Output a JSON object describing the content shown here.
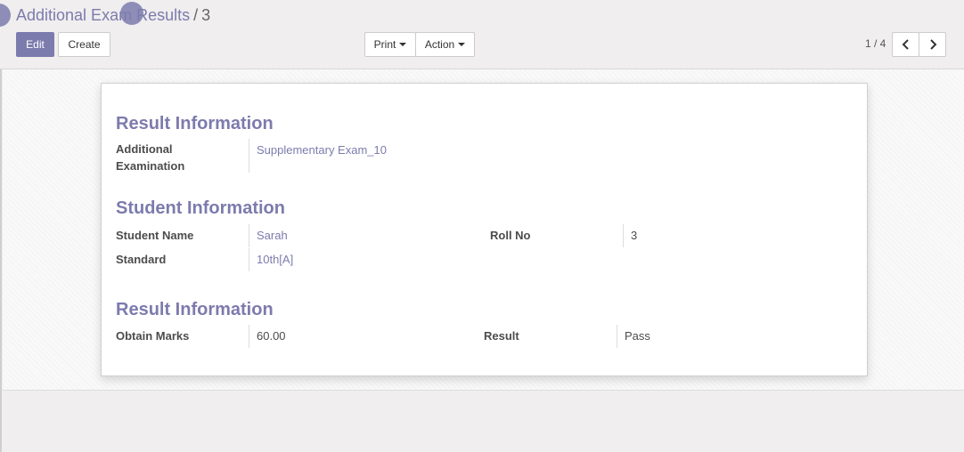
{
  "breadcrumb": {
    "parent": "Additional Exam Results",
    "separator": "/",
    "current": "3"
  },
  "toolbar": {
    "edit_label": "Edit",
    "create_label": "Create",
    "print_label": "Print",
    "action_label": "Action"
  },
  "pager": {
    "value": "1 / 4"
  },
  "form": {
    "sections": [
      {
        "title": "Result Information",
        "fields": [
          {
            "label": "Additional Examination",
            "value": "Supplementary Exam_10"
          }
        ]
      },
      {
        "title": "Student Information",
        "fields": [
          {
            "label": "Student Name",
            "value": "Sarah"
          },
          {
            "label": "Roll No",
            "value": "3"
          },
          {
            "label": "Standard",
            "value": "10th[A]"
          }
        ]
      },
      {
        "title": "Result Information",
        "fields": [
          {
            "label": "Obtain Marks",
            "value": "60.00"
          },
          {
            "label": "Result",
            "value": "Pass"
          }
        ]
      }
    ]
  },
  "colors": {
    "accent": "#7c7bad",
    "background": "#f0eeee",
    "sheet": "#ffffff"
  },
  "icons": {
    "previous": "chevron-left-icon",
    "next": "chevron-right-icon"
  }
}
